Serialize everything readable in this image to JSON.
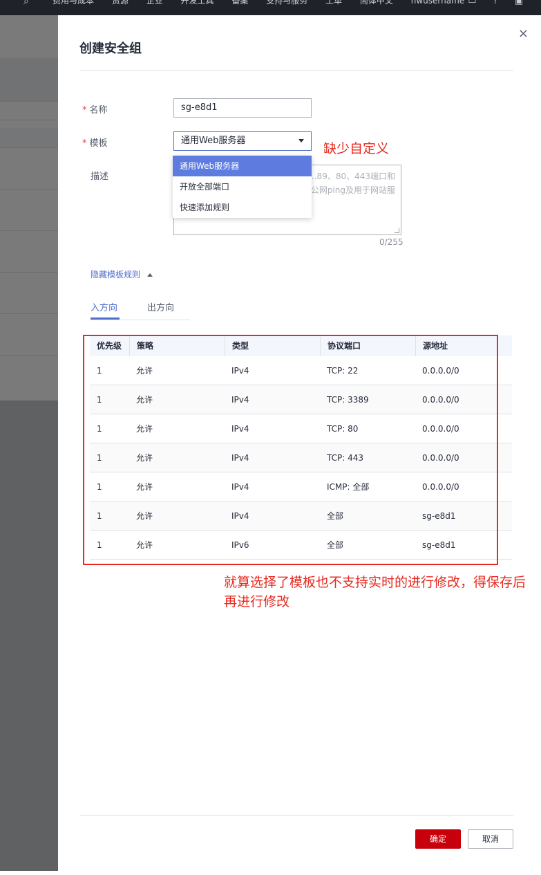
{
  "topbar": {
    "items": [
      "费用与成本",
      "资源",
      "企业",
      "开发工具",
      "备案",
      "支持与服务",
      "工单",
      "简体中文",
      "hwusername"
    ]
  },
  "drawer": {
    "title": "创建安全组",
    "close_icon": "×"
  },
  "form": {
    "name": {
      "required_mark": "*",
      "label": "名称",
      "value": "sg-e8d1"
    },
    "template": {
      "required_mark": "*",
      "label": "模板",
      "value": "通用Web服务器"
    },
    "description": {
      "label": "描述",
      "placeholder_line1": "...89、80、443端口和",
      "placeholder_line2": "...公网ping及用于网站服",
      "counter": "0/255"
    }
  },
  "dropdown": {
    "options": [
      "通用Web服务器",
      "开放全部端口",
      "快速添加规则"
    ],
    "selected_index": 0
  },
  "annotations": {
    "missing_custom": "缺少自定义",
    "note": "就算选择了模板也不支持实时的进行修改，得保存后再进行修改"
  },
  "rules_toggle": {
    "label": "隐藏模板规则"
  },
  "tabs": [
    {
      "label": "入方向",
      "active": true
    },
    {
      "label": "出方向",
      "active": false
    }
  ],
  "table": {
    "headers": [
      "优先级",
      "策略",
      "类型",
      "协议端口",
      "源地址"
    ],
    "rows": [
      [
        "1",
        "允许",
        "IPv4",
        "TCP: 22",
        "0.0.0.0/0"
      ],
      [
        "1",
        "允许",
        "IPv4",
        "TCP: 3389",
        "0.0.0.0/0"
      ],
      [
        "1",
        "允许",
        "IPv4",
        "TCP: 80",
        "0.0.0.0/0"
      ],
      [
        "1",
        "允许",
        "IPv4",
        "TCP: 443",
        "0.0.0.0/0"
      ],
      [
        "1",
        "允许",
        "IPv4",
        "ICMP: 全部",
        "0.0.0.0/0"
      ],
      [
        "1",
        "允许",
        "IPv4",
        "全部",
        "sg-e8d1"
      ],
      [
        "1",
        "允许",
        "IPv6",
        "全部",
        "sg-e8d1"
      ]
    ]
  },
  "footer": {
    "ok": "确定",
    "cancel": "取消"
  },
  "colors": {
    "accent": "#526ecc",
    "primary_button": "#c7000b",
    "annotation": "#e8291f",
    "selected_option": "#5e7ce0"
  }
}
